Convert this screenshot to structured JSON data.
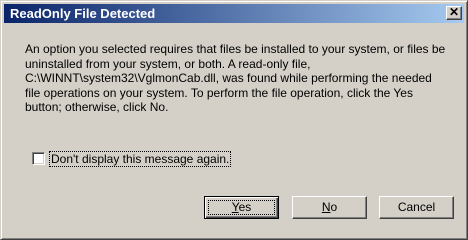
{
  "window": {
    "title": "ReadOnly File Detected",
    "close_glyph": "✕",
    "title_colors": [
      "#0a246a",
      "#a6caf0"
    ]
  },
  "message": "An option you selected requires that files be installed to your system, or files be\nuninstalled from your system, or both. A read-only file,\nC:\\WINNT\\system32\\VglmonCab.dll, was found while performing the needed\nfile operations on your system. To perform the file operation, click the Yes\nbutton; otherwise, click No.",
  "checkbox": {
    "label": "Don't display this message again.",
    "checked": false
  },
  "buttons": {
    "yes": {
      "mnemonic": "Y",
      "rest": "es"
    },
    "no": {
      "mnemonic": "N",
      "rest": "o"
    },
    "cancel": {
      "label": "Cancel"
    }
  }
}
